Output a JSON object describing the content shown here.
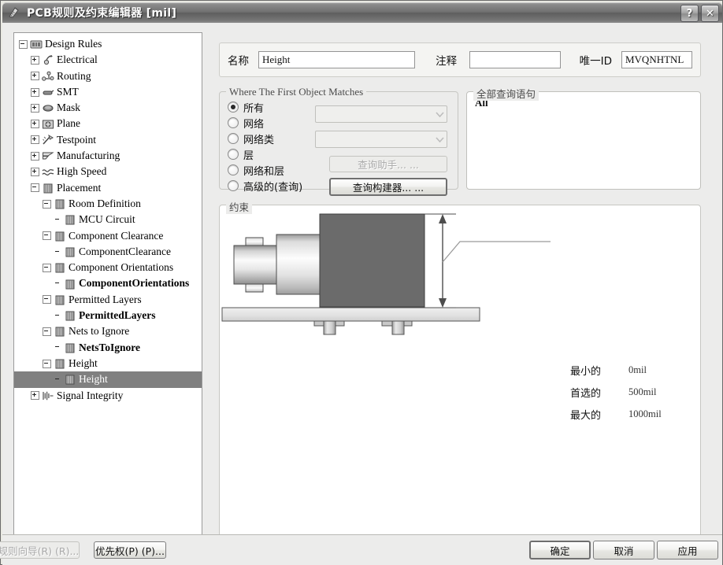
{
  "window": {
    "title": "PCB规则及约束编辑器  [mil]",
    "icon": "pcb-rules-icon",
    "help_button": "?",
    "close_button": "✕"
  },
  "tree": {
    "items": [
      {
        "label": "Design Rules",
        "depth": 0,
        "expander": "minus",
        "icon": "design-rules-icon",
        "bold": false,
        "selected": false
      },
      {
        "label": "Electrical",
        "depth": 1,
        "expander": "plus",
        "icon": "electrical-icon",
        "bold": false,
        "selected": false
      },
      {
        "label": "Routing",
        "depth": 1,
        "expander": "plus",
        "icon": "routing-icon",
        "bold": false,
        "selected": false
      },
      {
        "label": "SMT",
        "depth": 1,
        "expander": "plus",
        "icon": "smt-icon",
        "bold": false,
        "selected": false
      },
      {
        "label": "Mask",
        "depth": 1,
        "expander": "plus",
        "icon": "mask-icon",
        "bold": false,
        "selected": false
      },
      {
        "label": "Plane",
        "depth": 1,
        "expander": "plus",
        "icon": "plane-icon",
        "bold": false,
        "selected": false
      },
      {
        "label": "Testpoint",
        "depth": 1,
        "expander": "plus",
        "icon": "testpoint-icon",
        "bold": false,
        "selected": false
      },
      {
        "label": "Manufacturing",
        "depth": 1,
        "expander": "plus",
        "icon": "manufacturing-icon",
        "bold": false,
        "selected": false
      },
      {
        "label": "High Speed",
        "depth": 1,
        "expander": "plus",
        "icon": "high-speed-icon",
        "bold": false,
        "selected": false
      },
      {
        "label": "Placement",
        "depth": 1,
        "expander": "minus",
        "icon": "placement-icon",
        "bold": false,
        "selected": false
      },
      {
        "label": "Room Definition",
        "depth": 2,
        "expander": "minus",
        "icon": "placement-icon",
        "bold": false,
        "selected": false
      },
      {
        "label": "MCU Circuit",
        "depth": 3,
        "expander": "none",
        "icon": "placement-icon",
        "bold": false,
        "selected": false
      },
      {
        "label": "Component Clearance",
        "depth": 2,
        "expander": "minus",
        "icon": "placement-icon",
        "bold": false,
        "selected": false
      },
      {
        "label": "ComponentClearance",
        "depth": 3,
        "expander": "none",
        "icon": "placement-icon",
        "bold": false,
        "selected": false
      },
      {
        "label": "Component Orientations",
        "depth": 2,
        "expander": "minus",
        "icon": "placement-icon",
        "bold": false,
        "selected": false
      },
      {
        "label": "ComponentOrientations",
        "depth": 3,
        "expander": "none",
        "icon": "placement-icon",
        "bold": true,
        "selected": false
      },
      {
        "label": "Permitted Layers",
        "depth": 2,
        "expander": "minus",
        "icon": "placement-icon",
        "bold": false,
        "selected": false
      },
      {
        "label": "PermittedLayers",
        "depth": 3,
        "expander": "none",
        "icon": "placement-icon",
        "bold": true,
        "selected": false
      },
      {
        "label": "Nets to Ignore",
        "depth": 2,
        "expander": "minus",
        "icon": "placement-icon",
        "bold": false,
        "selected": false
      },
      {
        "label": "NetsToIgnore",
        "depth": 3,
        "expander": "none",
        "icon": "placement-icon",
        "bold": true,
        "selected": false
      },
      {
        "label": "Height",
        "depth": 2,
        "expander": "minus",
        "icon": "placement-icon",
        "bold": false,
        "selected": false
      },
      {
        "label": "Height",
        "depth": 3,
        "expander": "none",
        "icon": "placement-icon",
        "bold": false,
        "selected": true
      },
      {
        "label": "Signal Integrity",
        "depth": 1,
        "expander": "plus",
        "icon": "signal-integrity-icon",
        "bold": false,
        "selected": false
      }
    ]
  },
  "header": {
    "name_label": "名称",
    "name_value": "Height",
    "comment_label": "注释",
    "comment_value": "",
    "comment_placeholder": "",
    "unique_id_label": "唯一ID",
    "unique_id_value": "MVQNHTNL"
  },
  "where_panel": {
    "title": "Where The First Object Matches",
    "options": [
      {
        "label": "所有",
        "selected": true
      },
      {
        "label": "网络",
        "selected": false
      },
      {
        "label": "网络类",
        "selected": false
      },
      {
        "label": "层",
        "selected": false
      },
      {
        "label": "网络和层",
        "selected": false
      },
      {
        "label": "高级的(查询)",
        "selected": false
      }
    ],
    "net_combo_value": "",
    "netclass_combo_value": "",
    "query_helper_button": "查询助手... ...",
    "query_builder_button": "查询构建器... ..."
  },
  "query_panel": {
    "title": "全部查询语句",
    "text": "All"
  },
  "constraint_panel": {
    "title": "约束",
    "measurements": [
      {
        "name": "最小的",
        "value": "0mil"
      },
      {
        "name": "首选的",
        "value": "500mil"
      },
      {
        "name": "最大的",
        "value": "1000mil"
      }
    ],
    "diagram_name": "component-height-diagram"
  },
  "footer": {
    "rule_wizard_button": "规则向导(R) (R)...",
    "priorities_button": "优先权(P) (P)...",
    "ok_button": "确定",
    "cancel_button": "取消",
    "apply_button": "应用"
  }
}
